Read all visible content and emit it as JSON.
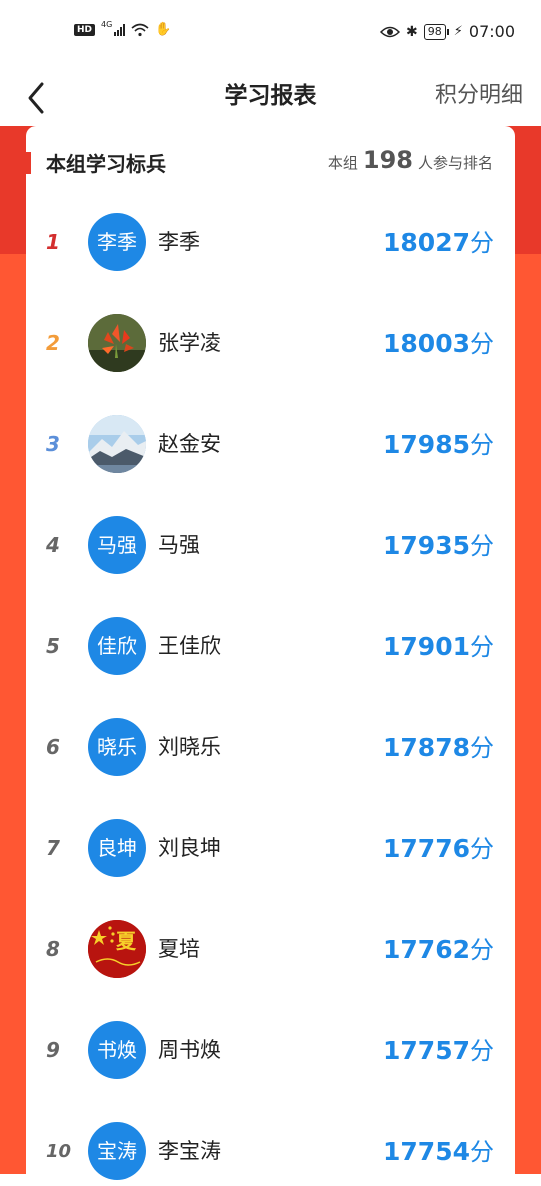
{
  "status_bar": {
    "hd": "HD",
    "network": "4G",
    "battery": "98",
    "time": "07:00"
  },
  "nav": {
    "title": "学习报表",
    "right_link": "积分明细"
  },
  "card": {
    "title": "本组学习标兵",
    "meta_prefix": "本组",
    "participant_count": "198",
    "meta_suffix": "人参与排名"
  },
  "colors": {
    "brand_red": "#e8392a",
    "side_red": "#ff5733",
    "score_blue": "#1e88e5",
    "avatar_blue": "#1e88e5",
    "rank1": "#d32f2f",
    "rank2": "#f39c3a",
    "rank3": "#5b8fd9"
  },
  "rankings": [
    {
      "rank": "1",
      "avatar_text": "李季",
      "name": "李季",
      "score": "18027",
      "unit": "分"
    },
    {
      "rank": "2",
      "avatar_text": "",
      "avatar_icon": "flower-photo",
      "name": "张学凌",
      "score": "18003",
      "unit": "分"
    },
    {
      "rank": "3",
      "avatar_text": "",
      "avatar_icon": "mountain-photo",
      "name": "赵金安",
      "score": "17985",
      "unit": "分"
    },
    {
      "rank": "4",
      "avatar_text": "马强",
      "name": "马强",
      "score": "17935",
      "unit": "分"
    },
    {
      "rank": "5",
      "avatar_text": "佳欣",
      "name": "王佳欣",
      "score": "17901",
      "unit": "分"
    },
    {
      "rank": "6",
      "avatar_text": "晓乐",
      "name": "刘晓乐",
      "score": "17878",
      "unit": "分"
    },
    {
      "rank": "7",
      "avatar_text": "良坤",
      "name": "刘良坤",
      "score": "17776",
      "unit": "分"
    },
    {
      "rank": "8",
      "avatar_text": "",
      "avatar_icon": "flag-photo",
      "avatar_logo_text": "夏",
      "name": "夏培",
      "score": "17762",
      "unit": "分"
    },
    {
      "rank": "9",
      "avatar_text": "书焕",
      "name": "周书焕",
      "score": "17757",
      "unit": "分"
    },
    {
      "rank": "10",
      "avatar_text": "宝涛",
      "name": "李宝涛",
      "score": "17754",
      "unit": "分"
    }
  ]
}
